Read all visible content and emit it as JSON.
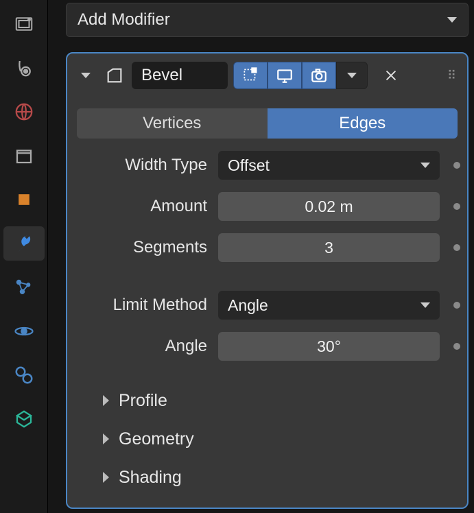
{
  "header": {
    "add_modifier": "Add Modifier"
  },
  "modifier": {
    "name": "Bevel",
    "tabs": {
      "vertices": "Vertices",
      "edges": "Edges",
      "active": "edges"
    },
    "props": {
      "width_type": {
        "label": "Width Type",
        "value": "Offset"
      },
      "amount": {
        "label": "Amount",
        "value": "0.02 m"
      },
      "segments": {
        "label": "Segments",
        "value": "3"
      },
      "limit_method": {
        "label": "Limit Method",
        "value": "Angle"
      },
      "angle": {
        "label": "Angle",
        "value": "30°"
      }
    },
    "subsections": {
      "profile": "Profile",
      "geometry": "Geometry",
      "shading": "Shading"
    }
  },
  "rail": {
    "icons": [
      "render-icon",
      "output-icon",
      "world-icon",
      "collection-icon",
      "object-icon",
      "modifier-icon",
      "particles-icon",
      "physics-icon",
      "constraints-icon",
      "data-icon"
    ],
    "active_index": 5
  }
}
